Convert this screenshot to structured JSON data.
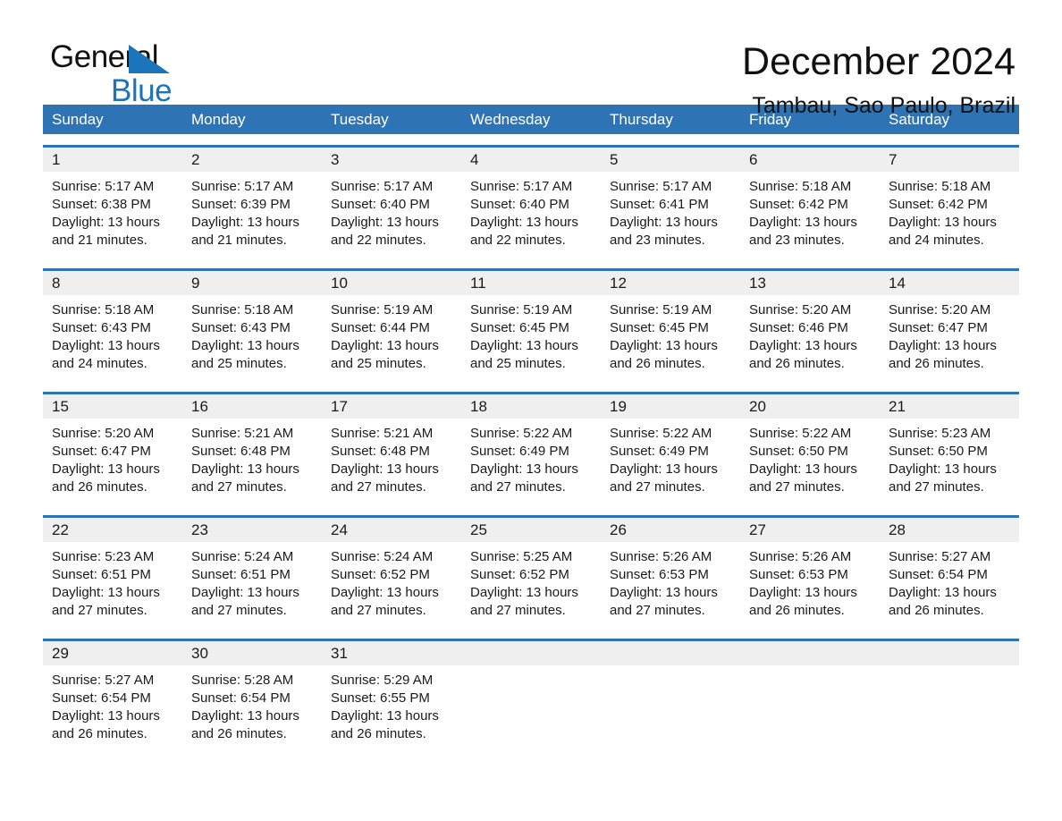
{
  "brand": {
    "name_part1": "General",
    "name_part2": "Blue",
    "triangle_color": "#1c74bb"
  },
  "header": {
    "month_title": "December 2024",
    "location": "Tambau, Sao Paulo, Brazil"
  },
  "theme": {
    "header_blue": "#2e74b5",
    "daynum_band": "#efefef",
    "text": "#1a1a1a"
  },
  "weekdays": [
    "Sunday",
    "Monday",
    "Tuesday",
    "Wednesday",
    "Thursday",
    "Friday",
    "Saturday"
  ],
  "weeks": [
    [
      {
        "day": "1",
        "sunrise": "Sunrise: 5:17 AM",
        "sunset": "Sunset: 6:38 PM",
        "daylight1": "Daylight: 13 hours",
        "daylight2": "and 21 minutes."
      },
      {
        "day": "2",
        "sunrise": "Sunrise: 5:17 AM",
        "sunset": "Sunset: 6:39 PM",
        "daylight1": "Daylight: 13 hours",
        "daylight2": "and 21 minutes."
      },
      {
        "day": "3",
        "sunrise": "Sunrise: 5:17 AM",
        "sunset": "Sunset: 6:40 PM",
        "daylight1": "Daylight: 13 hours",
        "daylight2": "and 22 minutes."
      },
      {
        "day": "4",
        "sunrise": "Sunrise: 5:17 AM",
        "sunset": "Sunset: 6:40 PM",
        "daylight1": "Daylight: 13 hours",
        "daylight2": "and 22 minutes."
      },
      {
        "day": "5",
        "sunrise": "Sunrise: 5:17 AM",
        "sunset": "Sunset: 6:41 PM",
        "daylight1": "Daylight: 13 hours",
        "daylight2": "and 23 minutes."
      },
      {
        "day": "6",
        "sunrise": "Sunrise: 5:18 AM",
        "sunset": "Sunset: 6:42 PM",
        "daylight1": "Daylight: 13 hours",
        "daylight2": "and 23 minutes."
      },
      {
        "day": "7",
        "sunrise": "Sunrise: 5:18 AM",
        "sunset": "Sunset: 6:42 PM",
        "daylight1": "Daylight: 13 hours",
        "daylight2": "and 24 minutes."
      }
    ],
    [
      {
        "day": "8",
        "sunrise": "Sunrise: 5:18 AM",
        "sunset": "Sunset: 6:43 PM",
        "daylight1": "Daylight: 13 hours",
        "daylight2": "and 24 minutes."
      },
      {
        "day": "9",
        "sunrise": "Sunrise: 5:18 AM",
        "sunset": "Sunset: 6:43 PM",
        "daylight1": "Daylight: 13 hours",
        "daylight2": "and 25 minutes."
      },
      {
        "day": "10",
        "sunrise": "Sunrise: 5:19 AM",
        "sunset": "Sunset: 6:44 PM",
        "daylight1": "Daylight: 13 hours",
        "daylight2": "and 25 minutes."
      },
      {
        "day": "11",
        "sunrise": "Sunrise: 5:19 AM",
        "sunset": "Sunset: 6:45 PM",
        "daylight1": "Daylight: 13 hours",
        "daylight2": "and 25 minutes."
      },
      {
        "day": "12",
        "sunrise": "Sunrise: 5:19 AM",
        "sunset": "Sunset: 6:45 PM",
        "daylight1": "Daylight: 13 hours",
        "daylight2": "and 26 minutes."
      },
      {
        "day": "13",
        "sunrise": "Sunrise: 5:20 AM",
        "sunset": "Sunset: 6:46 PM",
        "daylight1": "Daylight: 13 hours",
        "daylight2": "and 26 minutes."
      },
      {
        "day": "14",
        "sunrise": "Sunrise: 5:20 AM",
        "sunset": "Sunset: 6:47 PM",
        "daylight1": "Daylight: 13 hours",
        "daylight2": "and 26 minutes."
      }
    ],
    [
      {
        "day": "15",
        "sunrise": "Sunrise: 5:20 AM",
        "sunset": "Sunset: 6:47 PM",
        "daylight1": "Daylight: 13 hours",
        "daylight2": "and 26 minutes."
      },
      {
        "day": "16",
        "sunrise": "Sunrise: 5:21 AM",
        "sunset": "Sunset: 6:48 PM",
        "daylight1": "Daylight: 13 hours",
        "daylight2": "and 27 minutes."
      },
      {
        "day": "17",
        "sunrise": "Sunrise: 5:21 AM",
        "sunset": "Sunset: 6:48 PM",
        "daylight1": "Daylight: 13 hours",
        "daylight2": "and 27 minutes."
      },
      {
        "day": "18",
        "sunrise": "Sunrise: 5:22 AM",
        "sunset": "Sunset: 6:49 PM",
        "daylight1": "Daylight: 13 hours",
        "daylight2": "and 27 minutes."
      },
      {
        "day": "19",
        "sunrise": "Sunrise: 5:22 AM",
        "sunset": "Sunset: 6:49 PM",
        "daylight1": "Daylight: 13 hours",
        "daylight2": "and 27 minutes."
      },
      {
        "day": "20",
        "sunrise": "Sunrise: 5:22 AM",
        "sunset": "Sunset: 6:50 PM",
        "daylight1": "Daylight: 13 hours",
        "daylight2": "and 27 minutes."
      },
      {
        "day": "21",
        "sunrise": "Sunrise: 5:23 AM",
        "sunset": "Sunset: 6:50 PM",
        "daylight1": "Daylight: 13 hours",
        "daylight2": "and 27 minutes."
      }
    ],
    [
      {
        "day": "22",
        "sunrise": "Sunrise: 5:23 AM",
        "sunset": "Sunset: 6:51 PM",
        "daylight1": "Daylight: 13 hours",
        "daylight2": "and 27 minutes."
      },
      {
        "day": "23",
        "sunrise": "Sunrise: 5:24 AM",
        "sunset": "Sunset: 6:51 PM",
        "daylight1": "Daylight: 13 hours",
        "daylight2": "and 27 minutes."
      },
      {
        "day": "24",
        "sunrise": "Sunrise: 5:24 AM",
        "sunset": "Sunset: 6:52 PM",
        "daylight1": "Daylight: 13 hours",
        "daylight2": "and 27 minutes."
      },
      {
        "day": "25",
        "sunrise": "Sunrise: 5:25 AM",
        "sunset": "Sunset: 6:52 PM",
        "daylight1": "Daylight: 13 hours",
        "daylight2": "and 27 minutes."
      },
      {
        "day": "26",
        "sunrise": "Sunrise: 5:26 AM",
        "sunset": "Sunset: 6:53 PM",
        "daylight1": "Daylight: 13 hours",
        "daylight2": "and 27 minutes."
      },
      {
        "day": "27",
        "sunrise": "Sunrise: 5:26 AM",
        "sunset": "Sunset: 6:53 PM",
        "daylight1": "Daylight: 13 hours",
        "daylight2": "and 26 minutes."
      },
      {
        "day": "28",
        "sunrise": "Sunrise: 5:27 AM",
        "sunset": "Sunset: 6:54 PM",
        "daylight1": "Daylight: 13 hours",
        "daylight2": "and 26 minutes."
      }
    ],
    [
      {
        "day": "29",
        "sunrise": "Sunrise: 5:27 AM",
        "sunset": "Sunset: 6:54 PM",
        "daylight1": "Daylight: 13 hours",
        "daylight2": "and 26 minutes."
      },
      {
        "day": "30",
        "sunrise": "Sunrise: 5:28 AM",
        "sunset": "Sunset: 6:54 PM",
        "daylight1": "Daylight: 13 hours",
        "daylight2": "and 26 minutes."
      },
      {
        "day": "31",
        "sunrise": "Sunrise: 5:29 AM",
        "sunset": "Sunset: 6:55 PM",
        "daylight1": "Daylight: 13 hours",
        "daylight2": "and 26 minutes."
      },
      {
        "day": "",
        "sunrise": "",
        "sunset": "",
        "daylight1": "",
        "daylight2": ""
      },
      {
        "day": "",
        "sunrise": "",
        "sunset": "",
        "daylight1": "",
        "daylight2": ""
      },
      {
        "day": "",
        "sunrise": "",
        "sunset": "",
        "daylight1": "",
        "daylight2": ""
      },
      {
        "day": "",
        "sunrise": "",
        "sunset": "",
        "daylight1": "",
        "daylight2": ""
      }
    ]
  ]
}
